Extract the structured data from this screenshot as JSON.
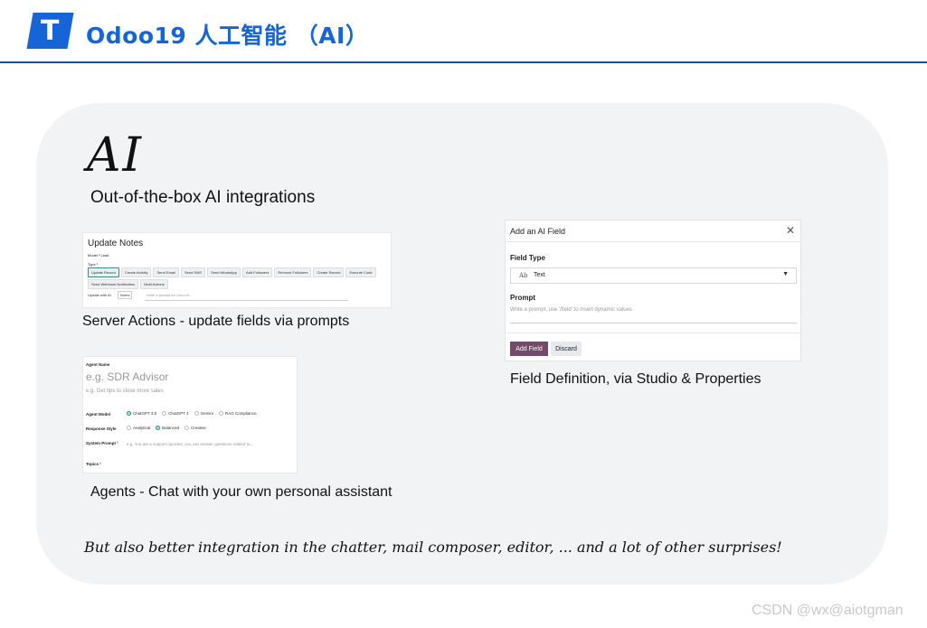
{
  "header": {
    "logo_glyph": "T",
    "title": "Odoo19 人工智能 （AI）",
    "brand_color": "#1565d8"
  },
  "hero": {
    "title": "AI",
    "subtitle": "Out-of-the-box AI integrations"
  },
  "update_card": {
    "title": "Update Notes",
    "model_label": "Model ²  Lead",
    "type_label": "Type ²",
    "tags": [
      "Update Record",
      "Create Activity",
      "Send Email",
      "Send SMS",
      "Send WhatsApp",
      "Add Followers",
      "Remove Followers",
      "Create Record",
      "Execute Code",
      "Send Webhook Notification",
      "Multi Actions"
    ],
    "update_label": "Update with AI",
    "update_field": "Notes",
    "update_placeholder": "Write a prompt for Odoo AI...",
    "caption": "Server Actions - update fields via prompts"
  },
  "field_card": {
    "title": "Add an AI Field",
    "close_glyph": "✕",
    "type_label": "Field Type",
    "type_icon": "Ab",
    "type_value": "Text",
    "caret": "▼",
    "prompt_label": "Prompt",
    "prompt_placeholder": "Write a prompt, use '/field' to insert dynamic values",
    "add_button": "Add Field",
    "discard_button": "Discard",
    "add_color": "#714b67",
    "caption": "Field Definition, via Studio & Properties"
  },
  "agent_card": {
    "name_label": "Agent Name",
    "name_placeholder": "e.g. SDR Advisor",
    "tips": "e.g. Get tips to close more sales",
    "model_label": "Agent Model",
    "models": [
      "ChatGPT 3.5",
      "ChatGPT 4",
      "Gemini",
      "RAG Compliance"
    ],
    "model_selected": 0,
    "style_label": "Response Style",
    "styles": [
      "Analytical",
      "Balanced",
      "Creative"
    ],
    "style_selected": 1,
    "prompt_label": "System Prompt ²",
    "prompt_placeholder": "e.g. You are a support operator, you can answer questions related to...",
    "topics_label": "Topics ²",
    "caption": "Agents - Chat with your own personal assistant"
  },
  "footer": {
    "line": "But also better integration in the chatter, mail composer, editor, ... and a lot of other surprises!",
    "watermark": "CSDN @wx@aiotgman"
  }
}
